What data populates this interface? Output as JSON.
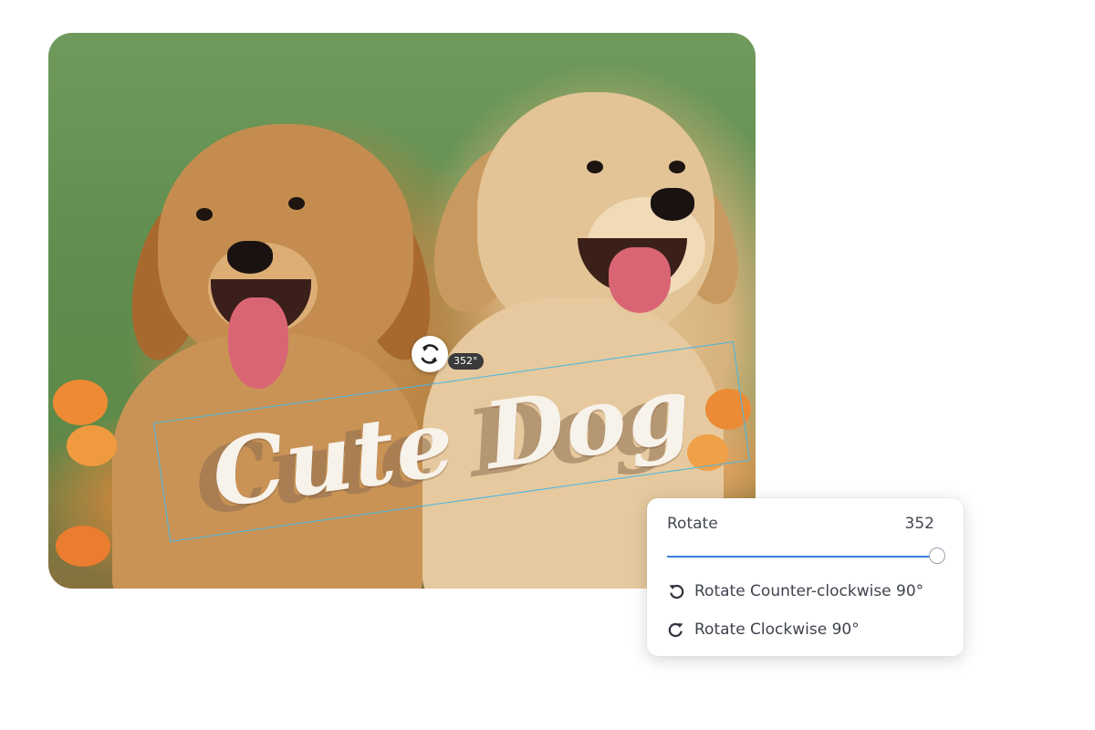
{
  "canvas": {
    "text": "Cute Dog",
    "angle_badge": "352°"
  },
  "rotate_panel": {
    "title": "Rotate",
    "value": "352",
    "slider": {
      "value": 352,
      "min": 0,
      "max": 360
    },
    "options": [
      {
        "label": "Rotate Counter-clockwise 90°",
        "icon": "rotate-ccw-icon"
      },
      {
        "label": "Rotate Clockwise 90°",
        "icon": "rotate-cw-icon"
      }
    ]
  },
  "colors": {
    "selection_border": "#45b6e6",
    "slider_accent": "#3d7fe0",
    "text_fill": "#f7f2ea"
  }
}
